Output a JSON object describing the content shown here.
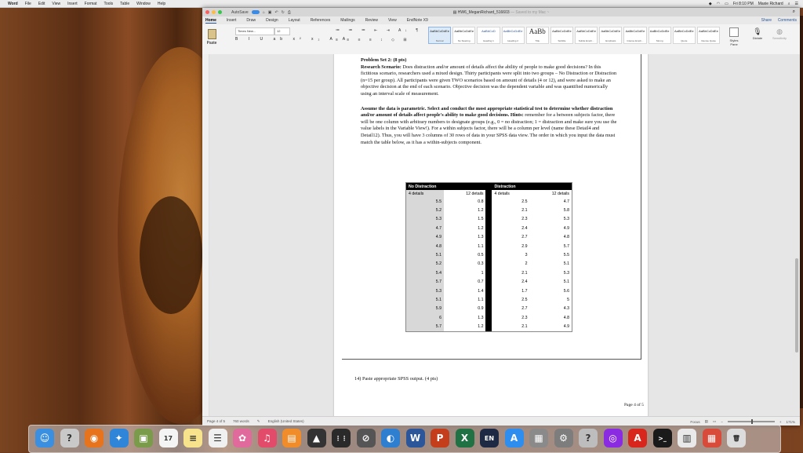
{
  "menubar": {
    "app": "Word",
    "items": [
      "File",
      "Edit",
      "View",
      "Insert",
      "Format",
      "Tools",
      "Table",
      "Window",
      "Help"
    ],
    "clock": "Fri 8:10 PM",
    "user": "Maxie Richard"
  },
  "window": {
    "title": "HW6_MeganRichard_516603",
    "saved_status": "— Saved to my Mac ~",
    "autosave_label": "AutoSave"
  },
  "ribbon": {
    "tabs": [
      "Home",
      "Insert",
      "Draw",
      "Design",
      "Layout",
      "References",
      "Mailings",
      "Review",
      "View",
      "EndNote X9"
    ],
    "active_tab": "Home",
    "share": "Share",
    "comments": "Comments",
    "paste_label": "Paste",
    "font_name": "Times New...",
    "font_size": "12",
    "format_buttons": "B I U ab x² x₂ A A",
    "para_row1": "≔ ≔ ≔ ⇤ ⇥ A↓ ¶",
    "para_row2": "≡ ≡ ≡ ≡ ↕ ◇ ⊞",
    "styles": [
      {
        "preview": "AaBbCcDdEe",
        "name": "Normal",
        "big": false,
        "blue": false,
        "selected": true
      },
      {
        "preview": "AaBbCcDdEe",
        "name": "No Spacing",
        "big": false,
        "blue": false,
        "selected": false
      },
      {
        "preview": "AaBbCcD",
        "name": "Heading 1",
        "big": false,
        "blue": true,
        "selected": false
      },
      {
        "preview": "AaBbCcDdEe",
        "name": "Heading 2",
        "big": false,
        "blue": true,
        "selected": false
      },
      {
        "preview": "AaBb",
        "name": "Title",
        "big": true,
        "blue": false,
        "selected": false
      },
      {
        "preview": "AaBbCcDdEe",
        "name": "Subtitle",
        "big": false,
        "blue": false,
        "selected": false
      },
      {
        "preview": "AaBbCcDdEe",
        "name": "Subtle Emph...",
        "big": false,
        "blue": false,
        "selected": false
      },
      {
        "preview": "AaBbCcDdEe",
        "name": "Emphasis",
        "big": false,
        "blue": false,
        "selected": false
      },
      {
        "preview": "AaBbCcDdEe",
        "name": "Intense Emph...",
        "big": false,
        "blue": false,
        "selected": false
      },
      {
        "preview": "AaBbCcDdEe",
        "name": "Strong",
        "big": false,
        "blue": false,
        "selected": false
      },
      {
        "preview": "AaBbCcDdEe",
        "name": "Quote",
        "big": false,
        "blue": false,
        "selected": false
      },
      {
        "preview": "AaBbCcDdEe",
        "name": "Intense Quote",
        "big": false,
        "blue": false,
        "selected": false
      }
    ],
    "styles_pane": "Styles Pane",
    "dictate": "Dictate",
    "sensitivity": "Sensitivity"
  },
  "document": {
    "heading": "Problem Set 2: (8 pts)",
    "scenario_label": "Research Scenario:",
    "scenario_text": " Does distraction and/or amount of details affect the ability of people to make good decisions? In this fictitious scenario, researchers used a mixed design. Thirty participants were split into two groups – No Distraction or Distraction (n=15 per group). All participants were given TWO scenarios based on amount of details (4 or 12), and were asked to make an objective decision at the end of each scenario. Objective decision was the dependent variable and was quantified numerically using an interval scale of measurement.",
    "instructions_bold": "Assume the data is parametric. Select and conduct the most appropriate statistical test to determine whether distraction and/or amount of details affect people's ability to make good decisions. Hints:",
    "instructions_text": " remember for a between subjects factor, there will be one column with arbitrary numbers to designate groups (e.g., 0 = no distraction; 1 = distraction and make sure you use the value labels in the Variable View!). For a within subjects factor, there will be a column per level (name these Detail4 and Detail12). Thus, you will have 3 columns of 30 rows of data in your SPSS data view. The order in which you input the data must match the table below, as it has a within-subjects component.",
    "question14": "14) Paste appropriate SPSS output. (4 pts)",
    "page_footer": "Page 4 of 5"
  },
  "table": {
    "group_headers": [
      "No Distraction",
      "Distraction"
    ],
    "sub_headers": [
      "4 details",
      "12 details",
      "4 details",
      "12 details"
    ],
    "rows": [
      [
        "5.5",
        "0.8",
        "2.5",
        "4.7"
      ],
      [
        "5.2",
        "1.2",
        "2.1",
        "5.8"
      ],
      [
        "5.3",
        "1.5",
        "2.3",
        "5.3"
      ],
      [
        "4.7",
        "1.2",
        "2.4",
        "4.9"
      ],
      [
        "4.9",
        "1.3",
        "2.7",
        "4.8"
      ],
      [
        "4.8",
        "1.1",
        "2.9",
        "5.7"
      ],
      [
        "5.1",
        "0.5",
        "3",
        "5.5"
      ],
      [
        "5.2",
        "0.3",
        "2",
        "5.1"
      ],
      [
        "5.4",
        "1",
        "2.1",
        "5.3"
      ],
      [
        "5.7",
        "0.7",
        "2.4",
        "5.1"
      ],
      [
        "5.3",
        "1.4",
        "1.7",
        "5.6"
      ],
      [
        "5.1",
        "1.1",
        "2.5",
        "5"
      ],
      [
        "5.9",
        "0.9",
        "2.7",
        "4.3"
      ],
      [
        "6",
        "1.3",
        "2.3",
        "4.8"
      ],
      [
        "5.7",
        "1.2",
        "2.1",
        "4.9"
      ]
    ]
  },
  "statusbar": {
    "page": "Page 4 of 5",
    "words": "760 words",
    "language": "English (United States)",
    "focus": "Focus",
    "zoom": "171%"
  },
  "dock": {
    "items": [
      {
        "name": "finder-icon",
        "glyph": "☺",
        "color": "#3b8fe0"
      },
      {
        "name": "help-icon",
        "glyph": "?",
        "color": "#c9c9c9"
      },
      {
        "name": "firefox-icon",
        "glyph": "◉",
        "color": "#e8731d"
      },
      {
        "name": "safari-icon",
        "glyph": "✦",
        "color": "#2f86d8"
      },
      {
        "name": "preview-icon",
        "glyph": "▣",
        "color": "#7a9c4a"
      },
      {
        "name": "calendar-icon",
        "glyph": "17",
        "color": "#f4f4f4"
      },
      {
        "name": "notes-icon",
        "glyph": "≡",
        "color": "#f6e38b"
      },
      {
        "name": "reminders-icon",
        "glyph": "☰",
        "color": "#f0f0f0"
      },
      {
        "name": "photos-icon",
        "glyph": "✿",
        "color": "#e06a9c"
      },
      {
        "name": "music-icon",
        "glyph": "♫",
        "color": "#e24b6a"
      },
      {
        "name": "books-icon",
        "glyph": "▤",
        "color": "#f08c2a"
      },
      {
        "name": "launchpad-icon",
        "glyph": "▲",
        "color": "#333333"
      },
      {
        "name": "grid-app-icon",
        "glyph": "⋮⋮",
        "color": "#2a2a2a"
      },
      {
        "name": "blocked-app-icon",
        "glyph": "⊘",
        "color": "#555555"
      },
      {
        "name": "network-app-icon",
        "glyph": "◐",
        "color": "#2f7fd0"
      },
      {
        "name": "word-icon",
        "glyph": "W",
        "color": "#2b579a"
      },
      {
        "name": "powerpoint-icon",
        "glyph": "P",
        "color": "#c43e1c"
      },
      {
        "name": "excel-icon",
        "glyph": "X",
        "color": "#207245"
      },
      {
        "name": "input-language-icon",
        "glyph": "EN",
        "color": "#1e2a44"
      },
      {
        "name": "app-store-icon",
        "glyph": "A",
        "color": "#2d8ef0"
      },
      {
        "name": "calculator-icon",
        "glyph": "▦",
        "color": "#8a8a8a"
      },
      {
        "name": "system-preferences-icon",
        "glyph": "⚙",
        "color": "#7d7d7d"
      },
      {
        "name": "help-viewer-icon",
        "glyph": "?",
        "color": "#bdbdbd"
      },
      {
        "name": "siri-icon",
        "glyph": "◎",
        "color": "#8a2be2"
      },
      {
        "name": "acrobat-icon",
        "glyph": "A",
        "color": "#d9261c"
      },
      {
        "name": "terminal-icon",
        "glyph": ">_",
        "color": "#1a1a1a"
      },
      {
        "name": "downloads-stack-icon",
        "glyph": "▥",
        "color": "#e9e9e9"
      },
      {
        "name": "documents-stack-icon",
        "glyph": "▦",
        "color": "#d84b3a"
      },
      {
        "name": "trash-icon",
        "glyph": "🗑",
        "color": "#dcdcdc"
      }
    ]
  }
}
